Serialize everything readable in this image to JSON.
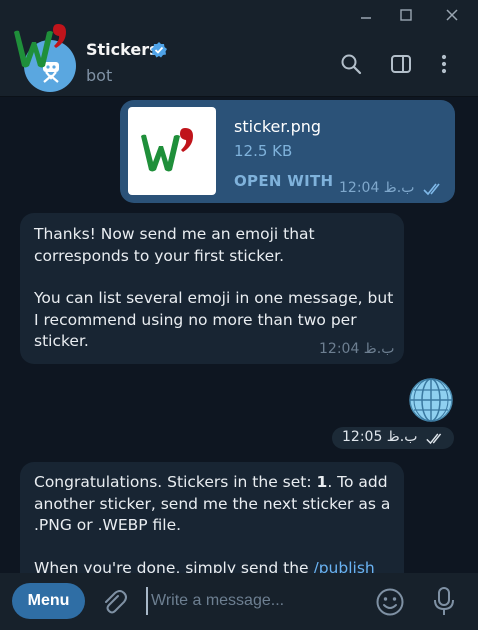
{
  "header": {
    "title": "Stickers",
    "subtitle": "bot"
  },
  "messages": {
    "file": {
      "name": "sticker.png",
      "size": "12.5 KB",
      "action": "OPEN WITH",
      "time": "12:04 ب.ظ"
    },
    "instructions": {
      "line1": "Thanks! Now send me an emoji that corresponds to your first sticker.",
      "line2": "You can list several emoji in one message, but I recommend using no more than two per sticker.",
      "time": "12:04 ب.ظ"
    },
    "emoji": {
      "time": "12:05 ب.ظ"
    },
    "congrats": {
      "p1_prefix": "Congratulations. Stickers in the set: ",
      "count": "1",
      "p1_suffix": ". To add another sticker, send me the next sticker as a .PNG or .WEBP file.",
      "p2_prefix": "When you're done, simply send the ",
      "command": "/publish"
    }
  },
  "composer": {
    "menu_label": "Menu",
    "placeholder": "Write a message..."
  },
  "colors": {
    "accent": "#2f6ea5",
    "bubble_out": "#2b5278",
    "bubble_in": "#182533",
    "background": "#0e1621",
    "logo_green": "#1f8f3a",
    "logo_red": "#c0141b"
  },
  "icons": [
    "w-logo",
    "robot",
    "verified-badge",
    "search-icon",
    "sidebar-toggle-icon",
    "more-vert-icon",
    "minimize-icon",
    "maximize-icon",
    "close-icon",
    "double-check-icon",
    "globe-emoji",
    "attach-icon",
    "emoji-icon",
    "mic-icon"
  ]
}
